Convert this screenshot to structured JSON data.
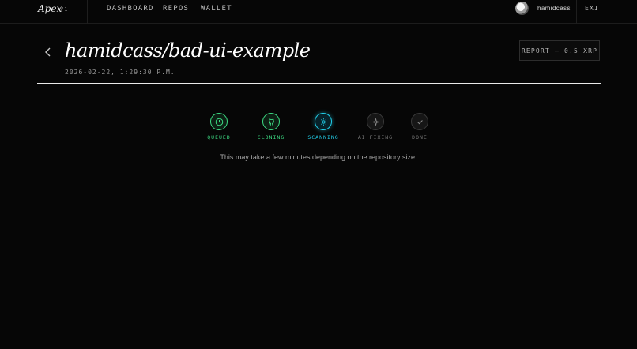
{
  "nav": {
    "logo": "Apex",
    "version": "V1",
    "items": [
      "DASHBOARD",
      "REPOS",
      "WALLET"
    ],
    "username": "hamidcass",
    "exit": "EXIT"
  },
  "header": {
    "title": "hamidcass/bad-ui-example",
    "timestamp": "2026-02-22, 1:29:30 P.M.",
    "report_button": "REPORT — 0.5 XRP"
  },
  "stepper": {
    "steps": [
      {
        "label": "QUEUED",
        "state": "done",
        "icon": "clock-icon",
        "color": "#3ddc84"
      },
      {
        "label": "CLONING",
        "state": "done",
        "icon": "github-icon",
        "color": "#3ddc84"
      },
      {
        "label": "SCANNING",
        "state": "active",
        "icon": "sun-icon",
        "color": "#22d3ee"
      },
      {
        "label": "AI FIXING",
        "state": "pending",
        "icon": "sparkle-icon",
        "color": "#8a8a8a"
      },
      {
        "label": "DONE",
        "state": "pending",
        "icon": "check-icon",
        "color": "#8a8a8a"
      }
    ],
    "note": "This may take a few minutes depending on the repository size."
  }
}
